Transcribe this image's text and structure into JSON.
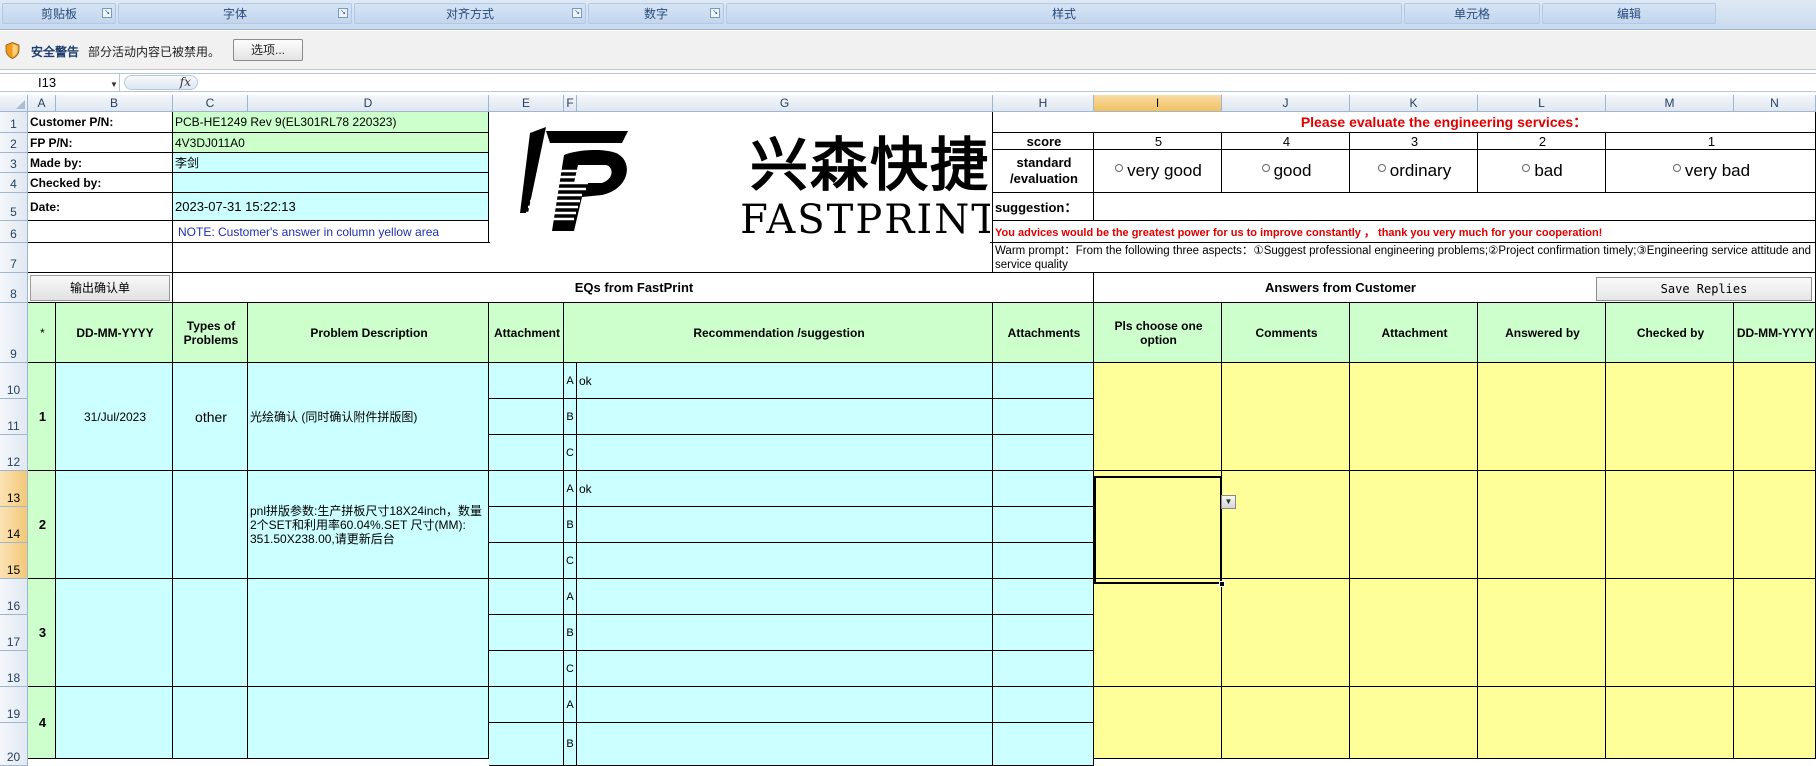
{
  "ribbon": {
    "groups": [
      "剪贴板",
      "字体",
      "对齐方式",
      "数字",
      "样式",
      "单元格",
      "编辑"
    ]
  },
  "security_bar": {
    "title": "安全警告",
    "message": "部分活动内容已被禁用。",
    "options_button": "选项..."
  },
  "formula_bar": {
    "name_box": "I13",
    "fx_label": "fx",
    "formula": ""
  },
  "columns": [
    "A",
    "B",
    "C",
    "D",
    "E",
    "F",
    "G",
    "H",
    "I",
    "J",
    "K",
    "L",
    "M",
    "N"
  ],
  "selected_column": "I",
  "rows": [
    "1",
    "2",
    "3",
    "4",
    "5",
    "6",
    "7",
    "8",
    "9",
    "10",
    "11",
    "12",
    "13",
    "14",
    "15",
    "16",
    "17",
    "18",
    "19",
    "20"
  ],
  "selected_rows": [
    "13",
    "14",
    "15"
  ],
  "header_info": {
    "customer_pn_label": "Customer P/N:",
    "customer_pn": "PCB-HE1249 Rev 9(EL301RL78 220323)",
    "fp_pn_label": "FP P/N:",
    "fp_pn": "4V3DJ011A0",
    "made_by_label": "Made by:",
    "made_by": "李剑",
    "checked_by_label": "Checked by:",
    "checked_by": "",
    "date_label": "Date:",
    "date": "2023-07-31 15:22:13",
    "note": "NOTE: Customer's  answer in column yellow area"
  },
  "logo": {
    "cn": "兴森快捷",
    "en": "FASTPRINT"
  },
  "evaluation": {
    "title": "Please evaluate the engineering services：",
    "score_label": "score",
    "scores": [
      "5",
      "4",
      "3",
      "2",
      "1"
    ],
    "standard_label": "standard /evaluation",
    "options": [
      "very good",
      "good",
      "ordinary",
      "bad",
      "very bad"
    ],
    "suggestion_label": "suggestion：",
    "advice": "You advices would be the greatest power for us to improve constantly ， thank you very much for your cooperation!",
    "warm_prompt": "Warm prompt：From the following three aspects：①Suggest professional engineering problems;②Project confirmation timely;③Engineering service attitude and service quality"
  },
  "buttons": {
    "export": "输出确认单",
    "save_replies": "Save Replies"
  },
  "section_titles": {
    "eqs": "EQs from FastPrint",
    "answers": "Answers from Customer"
  },
  "table_headers": {
    "star": "*",
    "date": "DD-MM-YYYY",
    "types": "Types of Problems",
    "description": "Problem Description",
    "attachment": "Attachment",
    "recommendation": "Recommendation /suggestion",
    "attachments": "Attachments",
    "choose": "Pls choose one option",
    "comments": "Comments",
    "attachment2": "Attachment",
    "answered_by": "Answered by",
    "checked_by": "Checked by",
    "date2": "DD-MM-YYYY"
  },
  "eqs": [
    {
      "no": "1",
      "date": "31/Jul/2023",
      "type": "other",
      "description": "光绘确认 (同时确认附件拼版图)",
      "options": [
        {
          "letter": "A",
          "text": "ok"
        },
        {
          "letter": "B",
          "text": ""
        },
        {
          "letter": "C",
          "text": ""
        }
      ]
    },
    {
      "no": "2",
      "date": "",
      "type": "",
      "description": "pnl拼版参数:生产拼板尺寸18X24inch，数量2个SET和利用率60.04%.SET 尺寸(MM): 351.50X238.00,请更新后台",
      "options": [
        {
          "letter": "A",
          "text": "ok"
        },
        {
          "letter": "B",
          "text": ""
        },
        {
          "letter": "C",
          "text": ""
        }
      ]
    },
    {
      "no": "3",
      "date": "",
      "type": "",
      "description": "",
      "options": [
        {
          "letter": "A",
          "text": ""
        },
        {
          "letter": "B",
          "text": ""
        },
        {
          "letter": "C",
          "text": ""
        }
      ]
    },
    {
      "no": "4",
      "date": "",
      "type": "",
      "description": "",
      "options": [
        {
          "letter": "A",
          "text": ""
        },
        {
          "letter": "B",
          "text": ""
        }
      ]
    }
  ]
}
